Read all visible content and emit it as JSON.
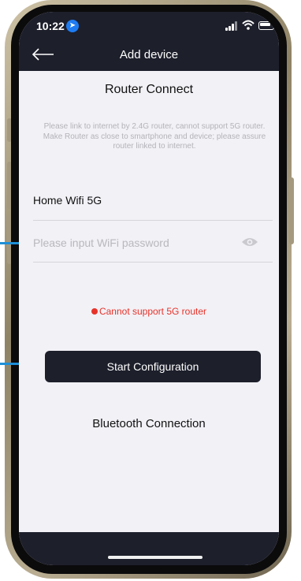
{
  "status_bar": {
    "time": "10:22"
  },
  "nav": {
    "title": "Add device"
  },
  "router": {
    "title": "Router Connect",
    "hint": "Please link to internet by 2.4G router, cannot support 5G router. Make Router as close to smartphone and device; please assure router linked to internet.",
    "ssid": "Home Wifi 5G",
    "password": {
      "placeholder": "Please input WiFi password",
      "value": ""
    },
    "error": "Cannot support 5G router",
    "start_label": "Start Configuration",
    "bluetooth_label": "Bluetooth Connection"
  },
  "icons": {
    "back": "arrow-left-icon",
    "location": "location-arrow-icon",
    "signal": "signal-icon",
    "wifi": "wifi-icon",
    "battery": "battery-icon",
    "eye": "eye-icon"
  },
  "colors": {
    "header_bg": "#1d1f2b",
    "screen_bg": "#f2f1f6",
    "error": "#e6332a",
    "annotation": "#1e8fd6"
  }
}
